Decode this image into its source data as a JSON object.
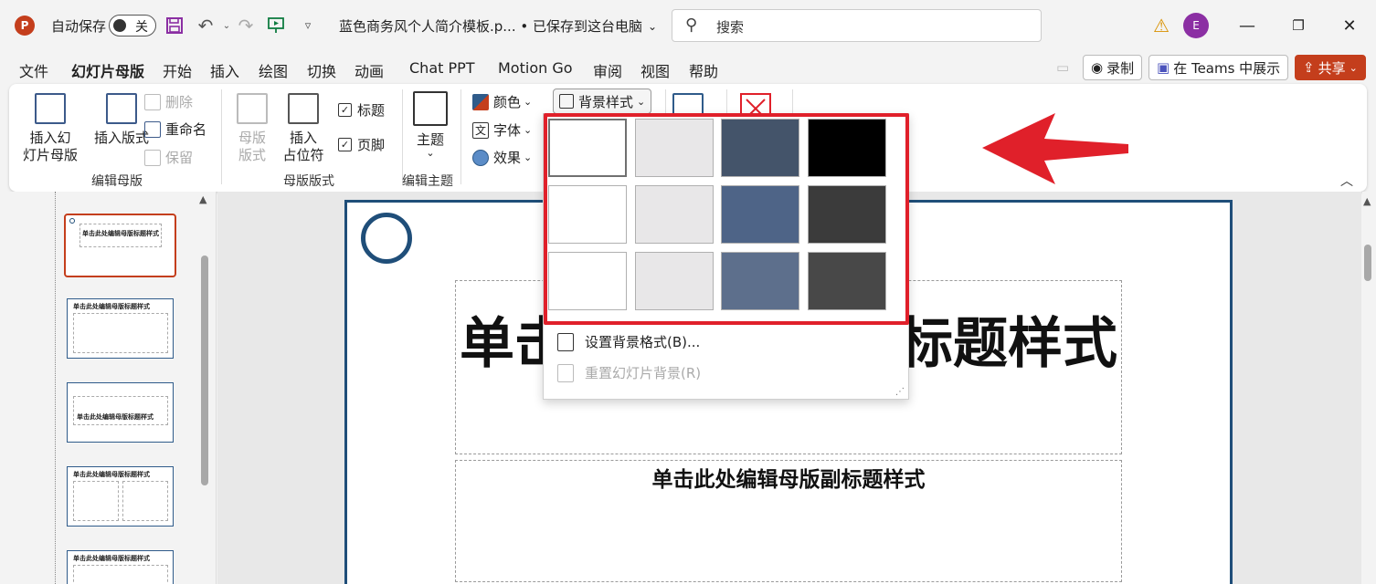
{
  "titlebar": {
    "app_logo": "P",
    "autosave_label": "自动保存",
    "autosave_state": "关",
    "doc_title": "蓝色商务风个人简介模板.p... • 已保存到这台电脑",
    "search_placeholder": "搜索",
    "user_initial": "E"
  },
  "menu": {
    "tabs": [
      "文件",
      "幻灯片母版",
      "开始",
      "插入",
      "绘图",
      "切换",
      "动画",
      "Chat PPT",
      "Motion Go",
      "审阅",
      "视图",
      "帮助"
    ],
    "active_tab": "幻灯片母版",
    "record_label": "录制",
    "teams_label": "在 Teams 中展示",
    "share_label": "共享"
  },
  "ribbon": {
    "insert_master": "插入幻\n灯片母版",
    "insert_layout": "插入版式",
    "delete": "删除",
    "rename": "重命名",
    "preserve": "保留",
    "group_edit_master": "编辑母版",
    "master_layout": "母版\n版式",
    "insert_placeholder": "插入\n占位符",
    "title_check": "标题",
    "footer_check": "页脚",
    "group_master_layout": "母版版式",
    "theme": "主题",
    "group_edit_theme": "编辑主题",
    "colors": "颜色",
    "fonts": "字体",
    "effects": "效果",
    "bg_styles": "背景样式"
  },
  "dropdown": {
    "swatch_colors": [
      [
        "#ffffff",
        "#e8e7e8",
        "#44546a",
        "#000000"
      ],
      [
        "#ffffff",
        "#e8e7e8",
        "#4e6487",
        "#3b3b3b"
      ],
      [
        "#ffffff",
        "#e8e7e8",
        "#5d6f8c",
        "#484848"
      ]
    ],
    "format_bg": "设置背景格式(B)...",
    "reset_bg": "重置幻灯片背景(R)"
  },
  "slide": {
    "title": "单击此处编辑母版标题样式",
    "subtitle": "单击此处编辑母版副标题样式"
  },
  "thumbnails": [
    {
      "text": "单击此处编辑母版标题样式"
    },
    {
      "text": "单击此处编辑母版标题样式"
    },
    {
      "text": "单击此处编辑母版标题样式"
    },
    {
      "text": "单击此处编辑母版标题样式"
    },
    {
      "text": "单击此处编辑母版标题样式"
    }
  ],
  "colors": {
    "accent": "#c43e1c",
    "slide_border": "#1f4e79",
    "highlight": "#e0202a"
  }
}
